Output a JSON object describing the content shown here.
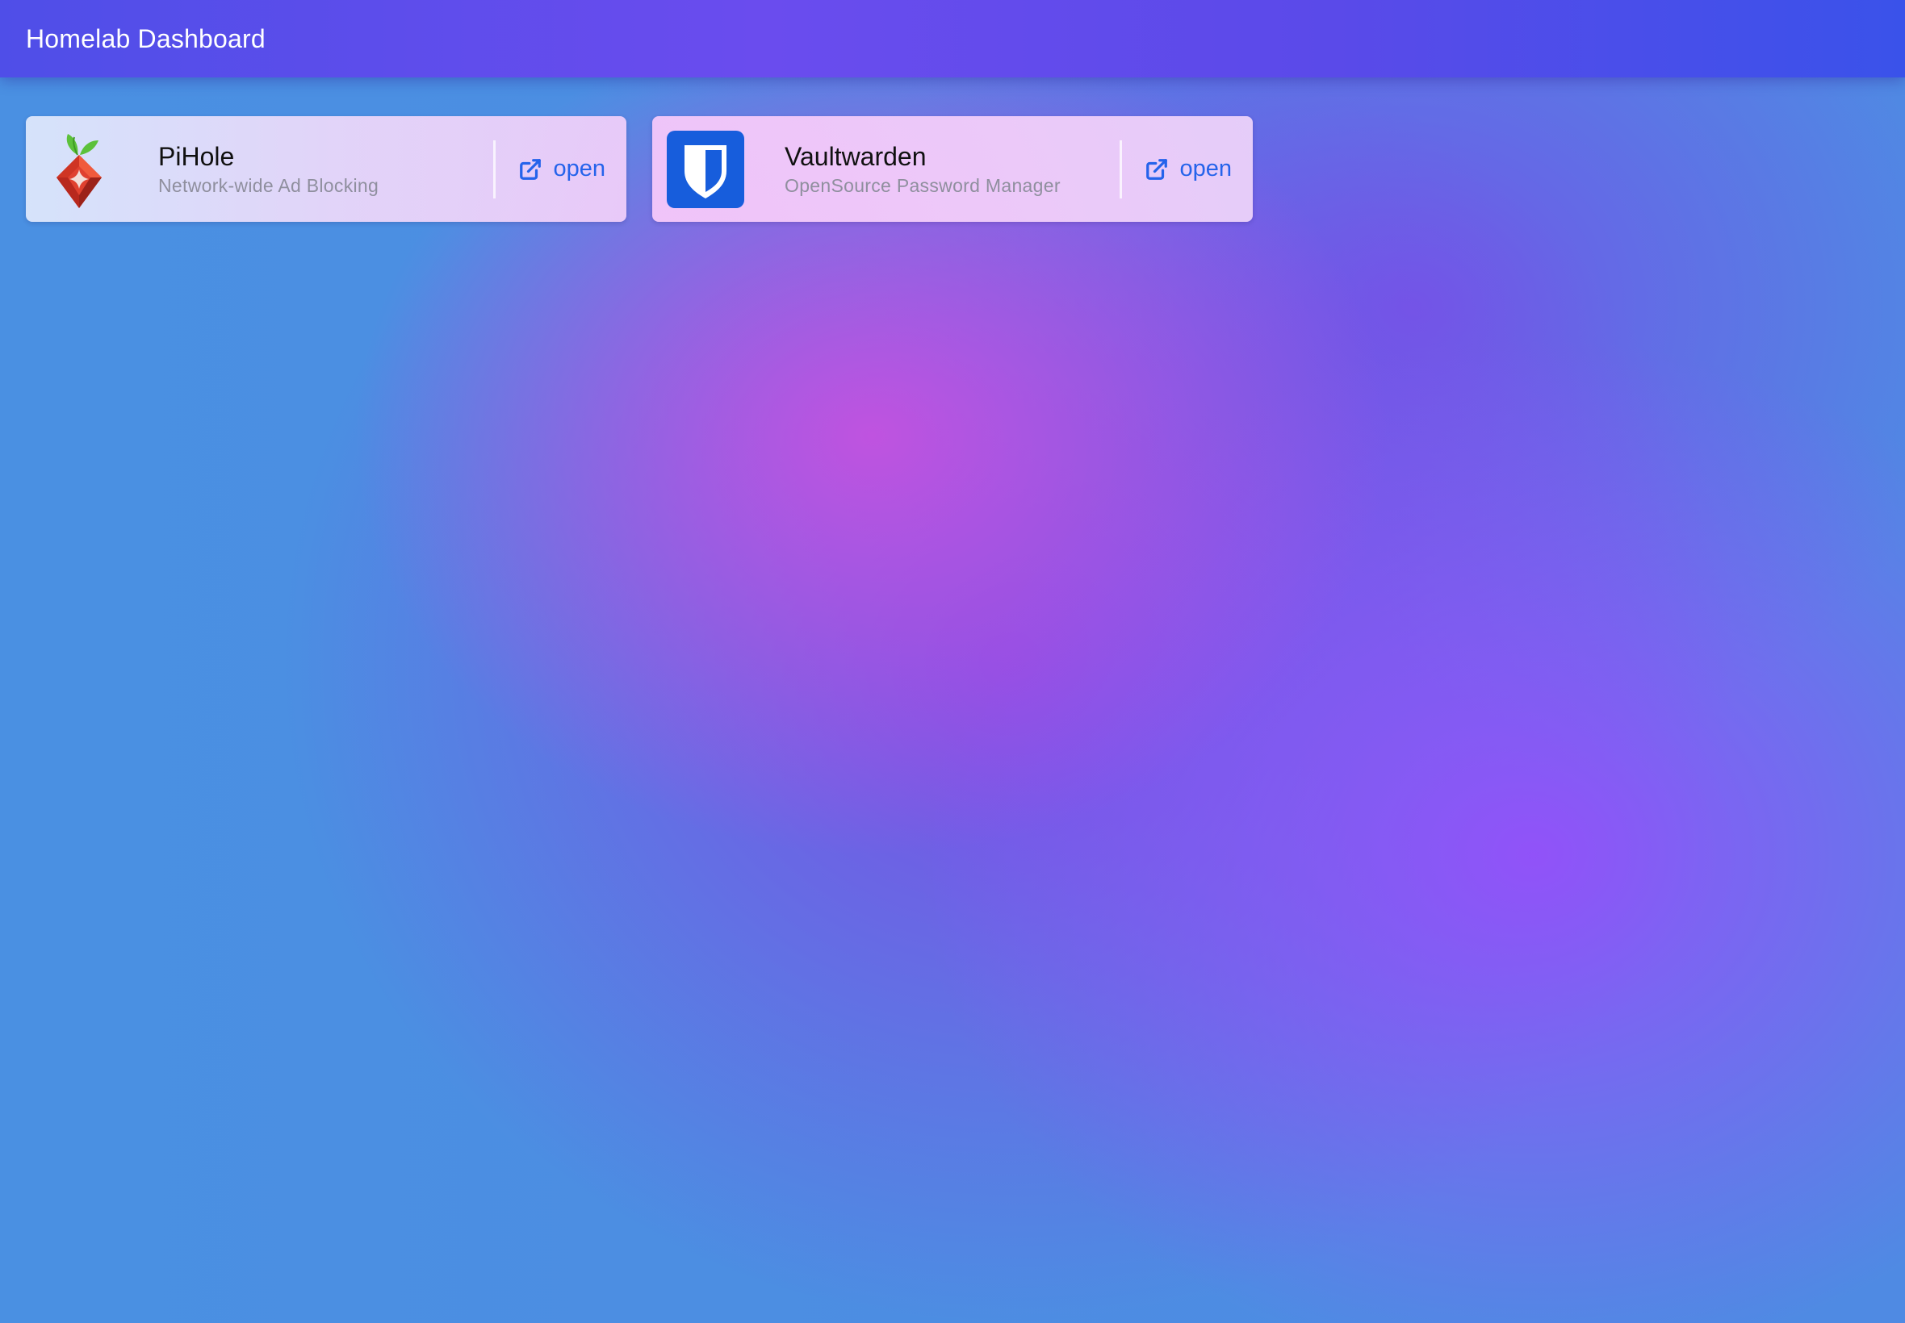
{
  "header": {
    "title": "Homelab Dashboard"
  },
  "colors": {
    "accent": "#2563eb",
    "pihole_red": "#e0412f",
    "pihole_leaf": "#5cc13a",
    "vault_blue": "#175ddc"
  },
  "services": [
    {
      "name": "PiHole",
      "description": "Network-wide Ad Blocking",
      "icon": "pihole-logo",
      "action_label": "open",
      "action_icon": "external-link-icon"
    },
    {
      "name": "Vaultwarden",
      "description": "OpenSource Password Manager",
      "icon": "vaultwarden-shield-logo",
      "action_label": "open",
      "action_icon": "external-link-icon"
    }
  ]
}
